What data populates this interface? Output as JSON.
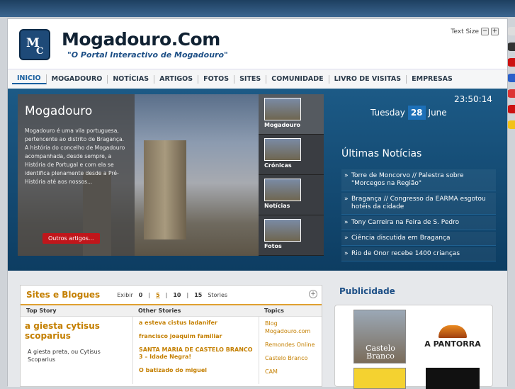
{
  "header": {
    "title": "Mogadouro.Com",
    "subtitle": "\"O Portal Interactivo de Mogadouro\"",
    "logo_letters": [
      "M",
      "C"
    ],
    "text_size_label": "Text Size",
    "text_size_minus": "−",
    "text_size_plus": "+"
  },
  "nav": {
    "items": [
      "INICIO",
      "MOGADOURO",
      "NOTÍCIAS",
      "ARTIGOS",
      "FOTOS",
      "SITES",
      "COMUNIDADE",
      "LIVRO DE VISITAS",
      "EMPRESAS"
    ]
  },
  "feature": {
    "title": "Mogadouro",
    "text": "Mogadouro é uma vila portuguesa, pertencente ao distrito de Bragança. A história do concelho de Mogadouro acompanhada, desde sempre, a História de Portugal e com ela se identifica plenamente desde a Pré-História até aos nossos...",
    "button": "Outros artigos...",
    "thumbs": [
      "Mogadouro",
      "Crónicas",
      "Notícias",
      "Fotos"
    ]
  },
  "clock": {
    "time": "23:50:14",
    "weekday": "Tuesday",
    "day": "28",
    "month": "June"
  },
  "news": {
    "title": "Últimas Notícias",
    "items": [
      "Torre de Moncorvo // Palestra sobre \"Morcegos na Região\"",
      "Bragança // Congresso da EARMA esgotou hotéis da cidade",
      "Tony Carreira na Feira de S. Pedro",
      "Ciência discutida em Bragança",
      "Rio de Onor recebe 1400 crianças"
    ]
  },
  "sites": {
    "title": "Sites e Blogues",
    "exibir": "Exibir",
    "opts": [
      "0",
      "5",
      "10",
      "15"
    ],
    "stories": "Stories",
    "plus": "+",
    "col_top": "Top Story",
    "col_other": "Other Stories",
    "col_topics": "Topics",
    "top_title": "a giesta cytisus scoparius",
    "top_desc": "A giesta preta, ou Cytisus Scoparius",
    "others": [
      "a esteva cistus ladanifer",
      "francisco joaquim familiar",
      "SANTA MARIA DE CASTELO BRANCO 3 – Idade Negra!",
      "O batizado do miguel"
    ],
    "topics": [
      "Blog Mogadouro.com",
      "Remondes Online",
      "Castelo Branco",
      "CAM"
    ]
  },
  "pub": {
    "title": "Publicidade",
    "ad1": "Castelo Branco",
    "ad2": "A PANTORRA"
  },
  "colors": {
    "accent": "#c47f00",
    "brand": "#1d4f86",
    "hero": "#1c5a86"
  }
}
